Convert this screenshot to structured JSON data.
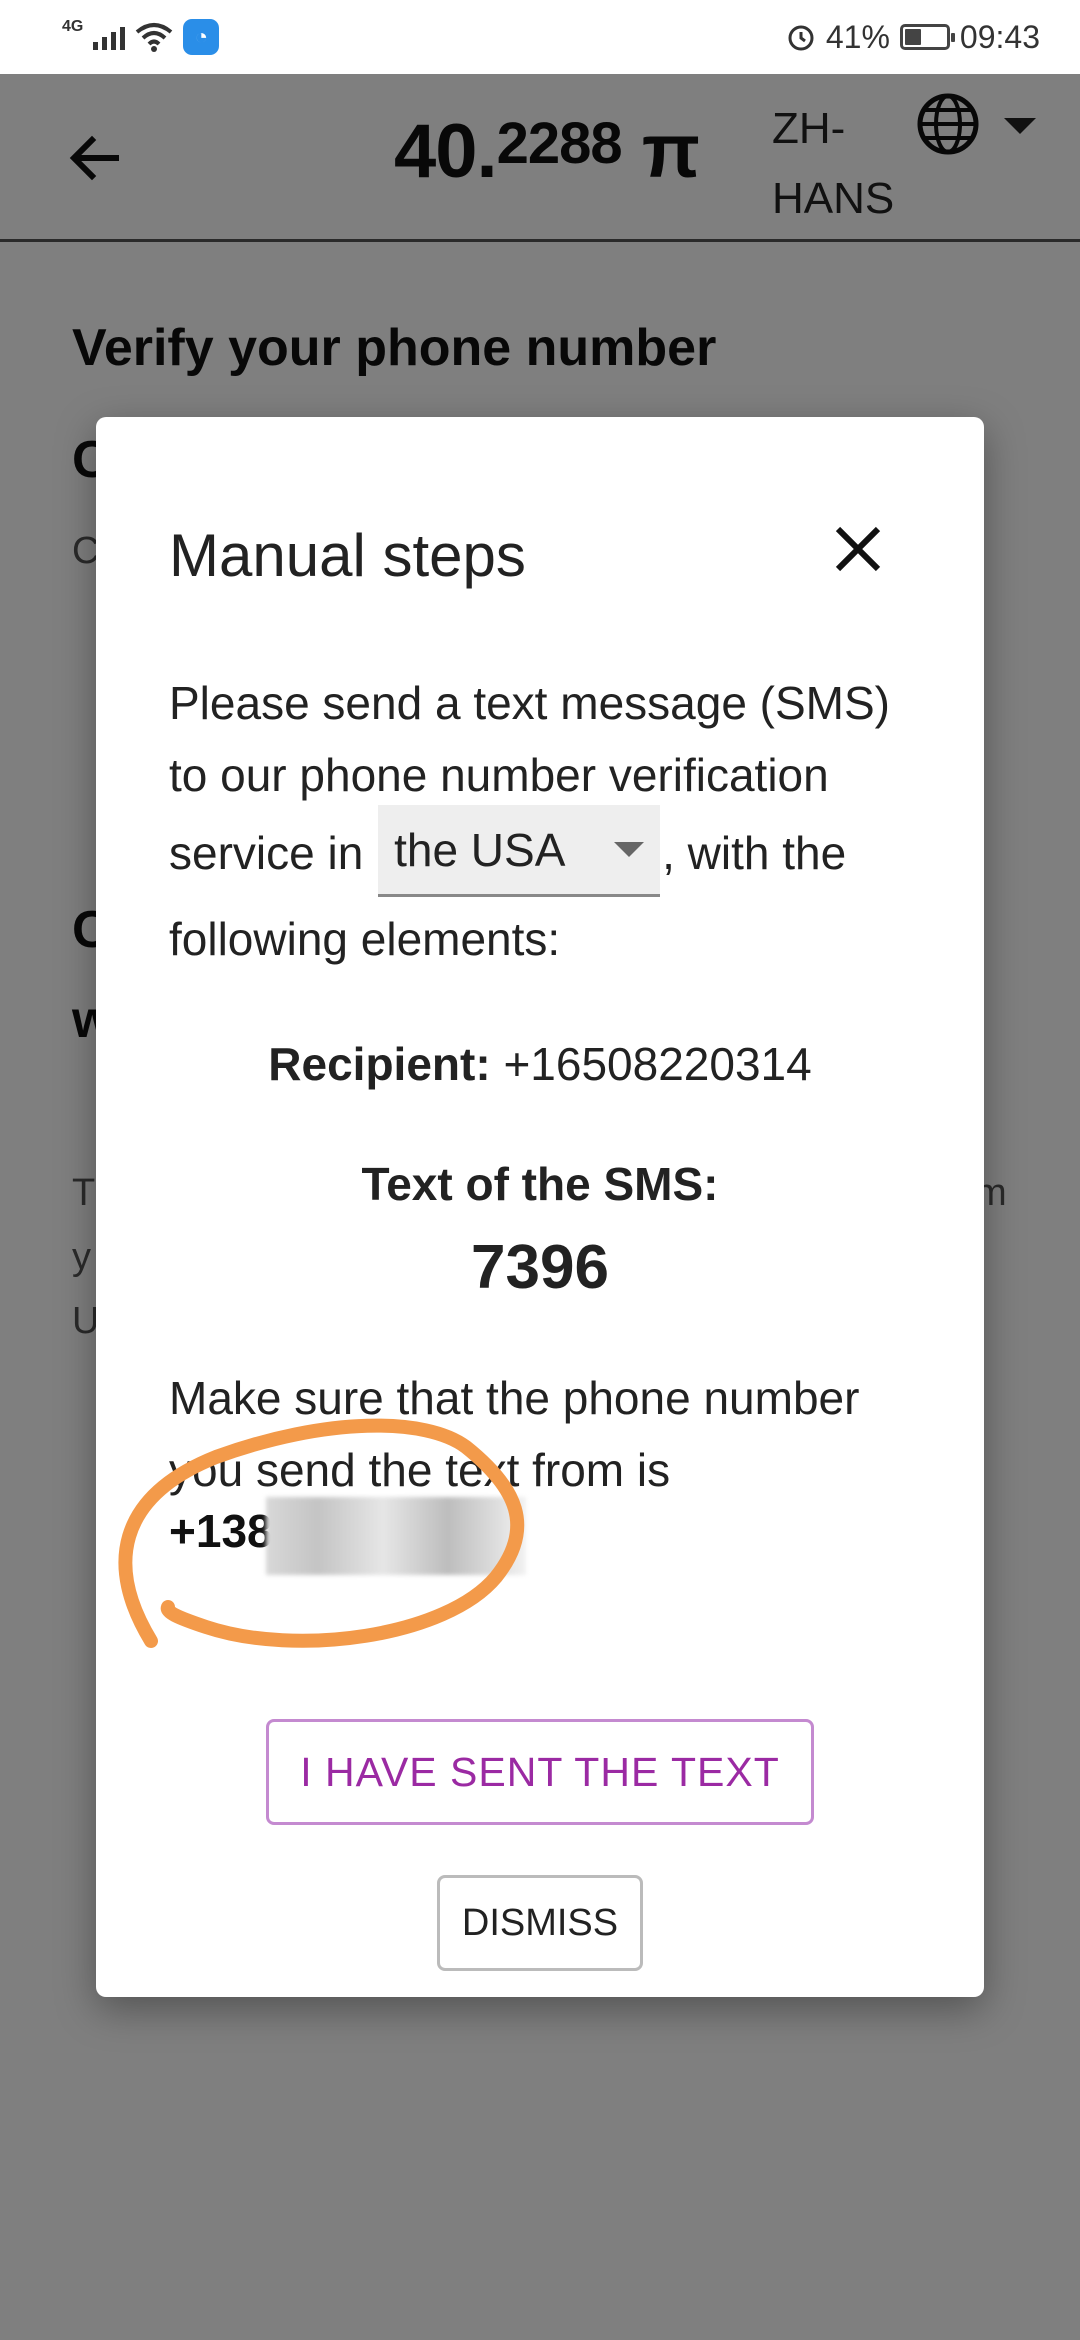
{
  "status_bar": {
    "network": "4G",
    "battery": "41%",
    "time": "09:43"
  },
  "header": {
    "balance_main": "40.",
    "balance_decimals": "2288",
    "currency": "π",
    "language": "ZH-HANS"
  },
  "background": {
    "title": "Verify your phone number",
    "fragments": [
      "C",
      "C",
      "C",
      "w",
      "T",
      "y",
      "U",
      "m"
    ]
  },
  "dialog": {
    "title": "Manual steps",
    "intro_before": "Please send a text message (SMS) to our phone number verification service in",
    "country": "the USA",
    "intro_after": ", with the following elements:",
    "recipient_label": "Recipient:",
    "recipient_number": "+16508220314",
    "sms_label": "Text of the SMS:",
    "sms_code": "7396",
    "make_sure": "Make sure that the phone number you send the text from is",
    "phone_partial": "+1380",
    "sent_button": "I HAVE SENT THE TEXT",
    "dismiss_button": "DISMISS"
  },
  "colors": {
    "accent": "#9b2aa3",
    "annotation": "#f39a4a",
    "overlay": "rgba(0,0,0,0.5)"
  }
}
